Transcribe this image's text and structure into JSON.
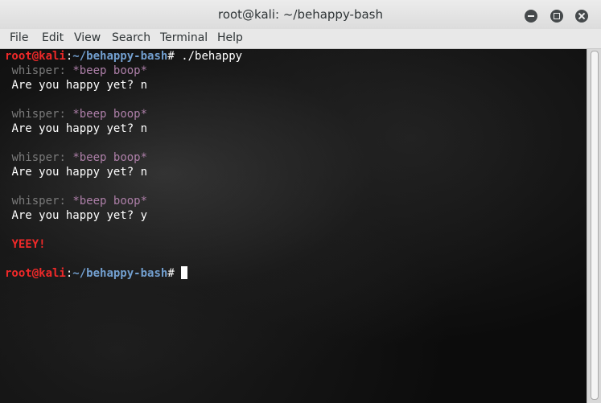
{
  "window": {
    "title": "root@kali: ~/behappy-bash"
  },
  "menu": {
    "items": [
      "File",
      "Edit",
      "View",
      "Search",
      "Terminal",
      "Help"
    ]
  },
  "terminal": {
    "prompt_user": "root@kali",
    "prompt_sep": ":",
    "prompt_path": "~/behappy-bash",
    "prompt_symbol": "#",
    "command": "./behappy",
    "rounds": [
      {
        "whisper_label": "whisper:",
        "whisper_text": "*beep boop*",
        "question": "Are you happy yet? n"
      },
      {
        "whisper_label": "whisper:",
        "whisper_text": "*beep boop*",
        "question": "Are you happy yet? n"
      },
      {
        "whisper_label": "whisper:",
        "whisper_text": "*beep boop*",
        "question": "Are you happy yet? n"
      },
      {
        "whisper_label": "whisper:",
        "whisper_text": "*beep boop*",
        "question": "Are you happy yet? y"
      }
    ],
    "result": "YEEY!"
  },
  "colors": {
    "prompt_user": "#ef2929",
    "prompt_path": "#729fcf",
    "whisper_label": "#7a7a7a",
    "whisper_text": "#ad7fa8",
    "result": "#ef2929"
  }
}
